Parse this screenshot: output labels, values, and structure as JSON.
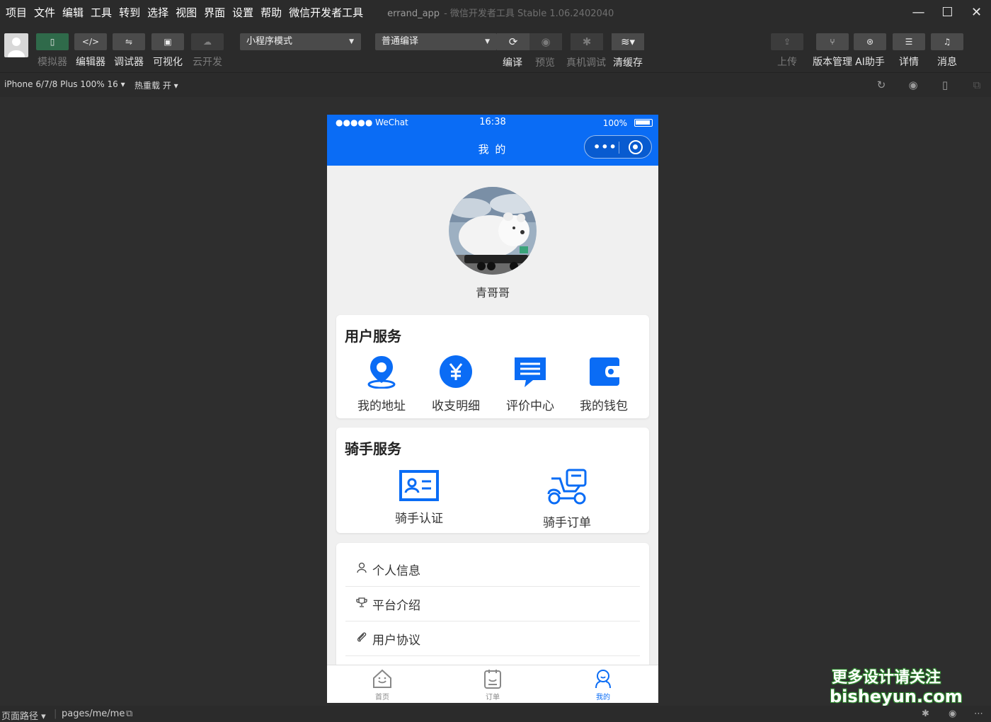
{
  "menu": [
    "项目",
    "文件",
    "编辑",
    "工具",
    "转到",
    "选择",
    "视图",
    "界面",
    "设置",
    "帮助",
    "微信开发者工具"
  ],
  "window": {
    "project": "errand_app",
    "app_name": "- 微信开发者工具 Stable 1.06.2402040"
  },
  "toolbar": {
    "left_tools": [
      "模拟器",
      "编辑器",
      "调试器",
      "可视化",
      "云开发"
    ],
    "mode_select": "小程序模式",
    "compile_select": "普通编译",
    "center_tools": [
      "编译",
      "预览",
      "真机调试",
      "清缓存"
    ],
    "right_tools": [
      "上传",
      "版本管理",
      "AI助手",
      "详情",
      "消息"
    ]
  },
  "subbar": {
    "device": "iPhone 6/7/8 Plus 100% 16 ▾",
    "hot_reload": "热重载 开 ▾"
  },
  "phone": {
    "status": {
      "signal": "●●●●● WeChat",
      "time": "16:38",
      "battery": "100%"
    },
    "nav_title": "我 的",
    "username": "青哥哥",
    "user_services": {
      "title": "用户服务",
      "items": [
        "我的地址",
        "收支明细",
        "评价中心",
        "我的钱包"
      ]
    },
    "rider_services": {
      "title": "骑手服务",
      "items": [
        "骑手认证",
        "骑手订单"
      ]
    },
    "menu_list": [
      "个人信息",
      "平台介绍",
      "用户协议"
    ],
    "tabs": [
      "首页",
      "订单",
      "我的"
    ],
    "colors": {
      "primary": "#0a6cf5"
    }
  },
  "footer": {
    "path_label": "页面路径 ▾",
    "path": "pages/me/me"
  },
  "watermark": {
    "line1": "更多设计请关注",
    "line2": "bisheyun.com"
  }
}
